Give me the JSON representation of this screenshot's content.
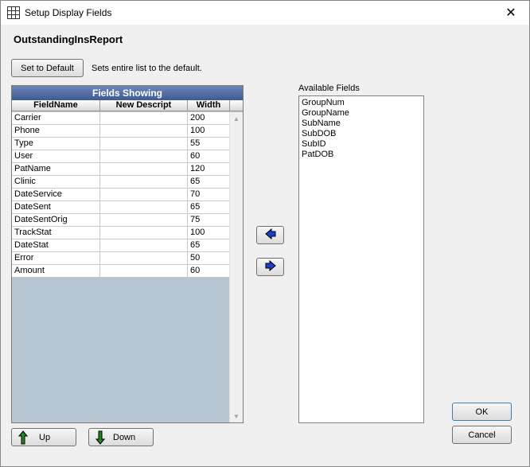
{
  "window": {
    "title": "Setup Display Fields",
    "close_glyph": "✕",
    "icon": "grid-icon"
  },
  "report_name": "OutstandingInsReport",
  "set_default": {
    "label": "Set to Default",
    "description": "Sets entire list to the default."
  },
  "fields_showing": {
    "title": "Fields Showing",
    "columns": [
      "FieldName",
      "New Descript",
      "Width"
    ],
    "rows": [
      {
        "field": "Carrier",
        "descript": "",
        "width": "200"
      },
      {
        "field": "Phone",
        "descript": "",
        "width": "100"
      },
      {
        "field": "Type",
        "descript": "",
        "width": "55"
      },
      {
        "field": "User",
        "descript": "",
        "width": "60"
      },
      {
        "field": "PatName",
        "descript": "",
        "width": "120"
      },
      {
        "field": "Clinic",
        "descript": "",
        "width": "65"
      },
      {
        "field": "DateService",
        "descript": "",
        "width": "70"
      },
      {
        "field": "DateSent",
        "descript": "",
        "width": "65"
      },
      {
        "field": "DateSentOrig",
        "descript": "",
        "width": "75"
      },
      {
        "field": "TrackStat",
        "descript": "",
        "width": "100"
      },
      {
        "field": "DateStat",
        "descript": "",
        "width": "65"
      },
      {
        "field": "Error",
        "descript": "",
        "width": "50"
      },
      {
        "field": "Amount",
        "descript": "",
        "width": "60"
      }
    ]
  },
  "available_fields": {
    "label": "Available Fields",
    "items": [
      "GroupNum",
      "GroupName",
      "SubName",
      "SubDOB",
      "SubID",
      "PatDOB"
    ]
  },
  "buttons": {
    "up": "Up",
    "down": "Down",
    "ok": "OK",
    "cancel": "Cancel"
  },
  "colors": {
    "grid_title_bg": "#3d5a96",
    "arrow_blue": "#1a3fd0",
    "arrow_green": "#1a8a1a"
  }
}
